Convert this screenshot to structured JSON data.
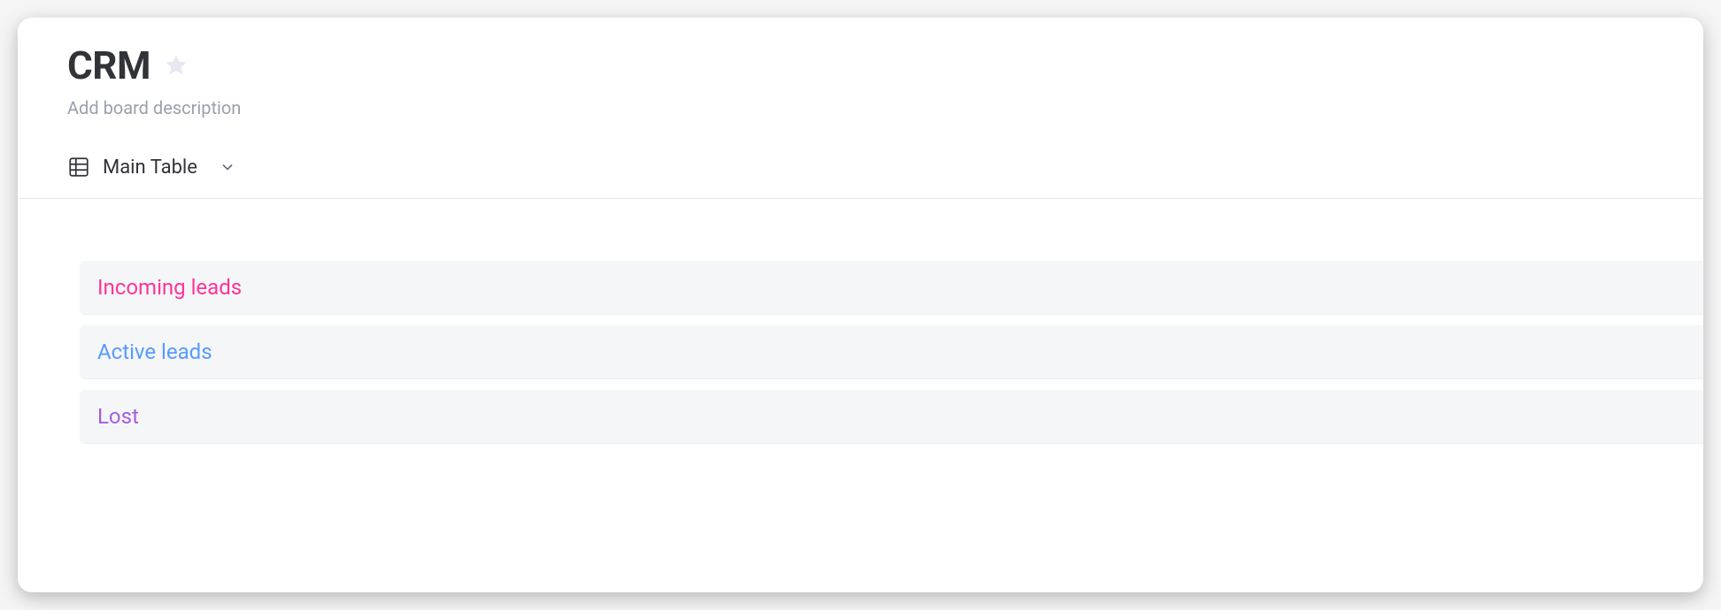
{
  "header": {
    "title": "CRM",
    "description_placeholder": "Add board description"
  },
  "view": {
    "label": "Main Table"
  },
  "groups": [
    {
      "label": "Incoming leads",
      "color": "#ff3399"
    },
    {
      "label": "Active leads",
      "color": "#579bfc"
    },
    {
      "label": "Lost",
      "color": "#a25ddc"
    }
  ],
  "icons": {
    "star": "star-icon",
    "table": "table-icon",
    "chevron": "chevron-down-icon"
  }
}
